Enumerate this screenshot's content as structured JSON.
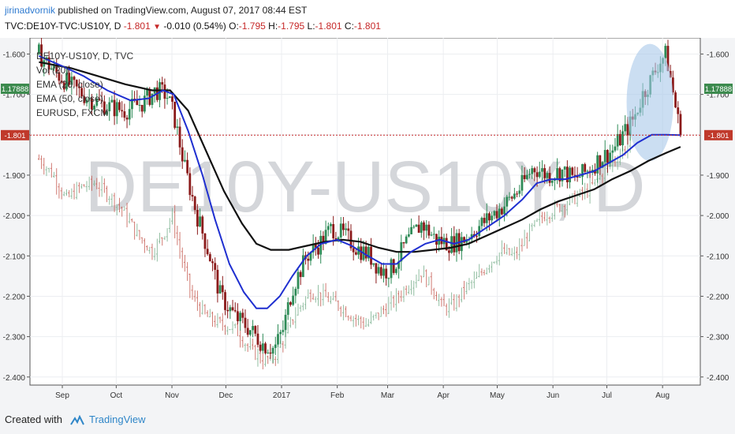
{
  "header": {
    "author": "jirinadvornik",
    "published_text": " published on TradingView.com, August 07, 2017 08:44 EST",
    "symbol": "TVC:DE10Y-TVC:US10Y, D",
    "last": "-1.801",
    "change": "-0.010 (0.54%)",
    "o_label": "O:",
    "o_value": "-1.795",
    "h_label": "H:",
    "h_value": "-1.795",
    "l_label": "L:",
    "l_value": "-1.801",
    "c_label": "C:",
    "c_value": "-1.801"
  },
  "footer": {
    "created_with": "Created with",
    "brand": "TradingView"
  },
  "colors": {
    "candle_up": "#2e8b57",
    "candle_down": "#8b1a1a",
    "ema20": "#1f2fd0",
    "ema50": "#111111",
    "eurusd": "#c8635a",
    "price_line": "#c62828",
    "highlight": "#a8c8ea",
    "badge_green": "#3c8a4e",
    "badge_red": "#c0392b",
    "watermark": "#d4d6da"
  },
  "chart_data": {
    "type": "candlestick",
    "watermark": "DE10Y-US10Y, D",
    "legend": [
      "DE10Y-US10Y, D, TVC",
      "Vol (20)",
      "EMA (20, close)",
      "EMA (50, close)",
      "EURUSD, FXCM"
    ],
    "y_axis_left": {
      "min": -2.42,
      "max": -1.56,
      "ticks": [
        "-1.600",
        "-1.700",
        "-1.800",
        "-1.900",
        "-2.000",
        "-2.100",
        "-2.200",
        "-2.300",
        "-2.400"
      ]
    },
    "y_axis_right": {
      "min": -2.42,
      "max": -1.56,
      "ticks": [
        "-1.600",
        "-1.700",
        "-1.900",
        "-2.000",
        "-2.100",
        "-2.200",
        "-2.300",
        "-2.400"
      ]
    },
    "left_badges": [
      {
        "label": "1.17888",
        "value": -1.686,
        "style": "green"
      },
      {
        "label": "-1.801",
        "value": -1.801,
        "style": "red"
      }
    ],
    "right_badges": [
      {
        "label": "1.17888",
        "value": -1.686,
        "style": "green"
      },
      {
        "label": "-1.801",
        "value": -1.801,
        "style": "red"
      }
    ],
    "current_price": -1.801,
    "x_labels": [
      {
        "label": "Sep",
        "day": 10
      },
      {
        "label": "Oct",
        "day": 40
      },
      {
        "label": "Nov",
        "day": 71
      },
      {
        "label": "Dec",
        "day": 101
      },
      {
        "label": "2017",
        "day": 132
      },
      {
        "label": "Feb",
        "day": 163
      },
      {
        "label": "Mar",
        "day": 191
      },
      {
        "label": "Apr",
        "day": 222
      },
      {
        "label": "May",
        "day": 252
      },
      {
        "label": "Jun",
        "day": 283
      },
      {
        "label": "Jul",
        "day": 313
      },
      {
        "label": "Aug",
        "day": 344
      }
    ],
    "x_domain": [
      -8,
      365
    ],
    "price_path": [
      [
        -3,
        -1.6
      ],
      [
        5,
        -1.64
      ],
      [
        15,
        -1.68
      ],
      [
        25,
        -1.71
      ],
      [
        35,
        -1.73
      ],
      [
        45,
        -1.74
      ],
      [
        55,
        -1.72
      ],
      [
        62,
        -1.69
      ],
      [
        68,
        -1.7
      ],
      [
        72,
        -1.75
      ],
      [
        78,
        -1.88
      ],
      [
        85,
        -2.0
      ],
      [
        92,
        -2.1
      ],
      [
        98,
        -2.2
      ],
      [
        106,
        -2.25
      ],
      [
        114,
        -2.28
      ],
      [
        122,
        -2.32
      ],
      [
        128,
        -2.33
      ],
      [
        133,
        -2.28
      ],
      [
        138,
        -2.18
      ],
      [
        146,
        -2.1
      ],
      [
        153,
        -2.07
      ],
      [
        160,
        -2.03
      ],
      [
        167,
        -2.05
      ],
      [
        174,
        -2.08
      ],
      [
        181,
        -2.1
      ],
      [
        188,
        -2.14
      ],
      [
        194,
        -2.13
      ],
      [
        201,
        -2.07
      ],
      [
        210,
        -2.02
      ],
      [
        218,
        -2.06
      ],
      [
        226,
        -2.07
      ],
      [
        233,
        -2.06
      ],
      [
        241,
        -2.03
      ],
      [
        249,
        -2.0
      ],
      [
        257,
        -1.97
      ],
      [
        265,
        -1.93
      ],
      [
        272,
        -1.88
      ],
      [
        280,
        -1.9
      ],
      [
        288,
        -1.89
      ],
      [
        295,
        -1.91
      ],
      [
        302,
        -1.89
      ],
      [
        309,
        -1.86
      ],
      [
        316,
        -1.84
      ],
      [
        322,
        -1.8
      ],
      [
        328,
        -1.76
      ],
      [
        333,
        -1.7
      ],
      [
        338,
        -1.66
      ],
      [
        342,
        -1.62
      ],
      [
        346,
        -1.6
      ],
      [
        350,
        -1.7
      ],
      [
        354,
        -1.8
      ]
    ],
    "ema20": [
      [
        -3,
        -1.605
      ],
      [
        10,
        -1.63
      ],
      [
        22,
        -1.655
      ],
      [
        35,
        -1.69
      ],
      [
        48,
        -1.715
      ],
      [
        58,
        -1.71
      ],
      [
        66,
        -1.69
      ],
      [
        72,
        -1.7
      ],
      [
        80,
        -1.79
      ],
      [
        88,
        -1.9
      ],
      [
        95,
        -2.01
      ],
      [
        103,
        -2.12
      ],
      [
        111,
        -2.19
      ],
      [
        118,
        -2.23
      ],
      [
        124,
        -2.23
      ],
      [
        131,
        -2.2
      ],
      [
        138,
        -2.15
      ],
      [
        146,
        -2.1
      ],
      [
        154,
        -2.07
      ],
      [
        163,
        -2.06
      ],
      [
        171,
        -2.075
      ],
      [
        180,
        -2.1
      ],
      [
        188,
        -2.12
      ],
      [
        196,
        -2.12
      ],
      [
        204,
        -2.09
      ],
      [
        212,
        -2.07
      ],
      [
        220,
        -2.06
      ],
      [
        228,
        -2.07
      ],
      [
        236,
        -2.06
      ],
      [
        246,
        -2.03
      ],
      [
        256,
        -2.0
      ],
      [
        266,
        -1.96
      ],
      [
        274,
        -1.92
      ],
      [
        282,
        -1.91
      ],
      [
        290,
        -1.91
      ],
      [
        298,
        -1.9
      ],
      [
        306,
        -1.89
      ],
      [
        314,
        -1.87
      ],
      [
        322,
        -1.85
      ],
      [
        330,
        -1.82
      ],
      [
        338,
        -1.8
      ],
      [
        346,
        -1.8
      ],
      [
        354,
        -1.801
      ]
    ],
    "ema50": [
      [
        -3,
        -1.62
      ],
      [
        15,
        -1.635
      ],
      [
        30,
        -1.655
      ],
      [
        45,
        -1.675
      ],
      [
        60,
        -1.69
      ],
      [
        70,
        -1.69
      ],
      [
        80,
        -1.74
      ],
      [
        90,
        -1.84
      ],
      [
        100,
        -1.94
      ],
      [
        110,
        -2.02
      ],
      [
        118,
        -2.07
      ],
      [
        126,
        -2.085
      ],
      [
        136,
        -2.085
      ],
      [
        146,
        -2.075
      ],
      [
        156,
        -2.065
      ],
      [
        166,
        -2.06
      ],
      [
        176,
        -2.065
      ],
      [
        186,
        -2.08
      ],
      [
        196,
        -2.09
      ],
      [
        206,
        -2.09
      ],
      [
        216,
        -2.085
      ],
      [
        226,
        -2.08
      ],
      [
        236,
        -2.07
      ],
      [
        246,
        -2.05
      ],
      [
        256,
        -2.03
      ],
      [
        266,
        -2.01
      ],
      [
        276,
        -1.985
      ],
      [
        286,
        -1.965
      ],
      [
        296,
        -1.95
      ],
      [
        306,
        -1.935
      ],
      [
        316,
        -1.91
      ],
      [
        326,
        -1.89
      ],
      [
        336,
        -1.865
      ],
      [
        346,
        -1.845
      ],
      [
        354,
        -1.83
      ]
    ],
    "eurusd_path": [
      [
        -3,
        -1.86
      ],
      [
        5,
        -1.9
      ],
      [
        12,
        -1.96
      ],
      [
        20,
        -1.93
      ],
      [
        28,
        -1.92
      ],
      [
        36,
        -1.95
      ],
      [
        44,
        -1.99
      ],
      [
        52,
        -2.05
      ],
      [
        60,
        -2.09
      ],
      [
        66,
        -2.05
      ],
      [
        71,
        -2.0
      ],
      [
        76,
        -2.1
      ],
      [
        82,
        -2.2
      ],
      [
        90,
        -2.25
      ],
      [
        98,
        -2.27
      ],
      [
        106,
        -2.28
      ],
      [
        114,
        -2.33
      ],
      [
        122,
        -2.36
      ],
      [
        128,
        -2.35
      ],
      [
        134,
        -2.3
      ],
      [
        140,
        -2.24
      ],
      [
        148,
        -2.19
      ],
      [
        155,
        -2.2
      ],
      [
        163,
        -2.22
      ],
      [
        171,
        -2.25
      ],
      [
        179,
        -2.27
      ],
      [
        187,
        -2.24
      ],
      [
        195,
        -2.21
      ],
      [
        203,
        -2.17
      ],
      [
        210,
        -2.14
      ],
      [
        216,
        -2.18
      ],
      [
        222,
        -2.23
      ],
      [
        228,
        -2.22
      ],
      [
        234,
        -2.18
      ],
      [
        240,
        -2.16
      ],
      [
        247,
        -2.12
      ],
      [
        254,
        -2.09
      ],
      [
        262,
        -2.1
      ],
      [
        270,
        -2.04
      ],
      [
        278,
        -2.0
      ],
      [
        286,
        -1.98
      ],
      [
        294,
        -1.96
      ],
      [
        302,
        -1.94
      ],
      [
        310,
        -1.9
      ],
      [
        318,
        -1.86
      ],
      [
        326,
        -1.82
      ]
    ],
    "highlight": {
      "cx_day": 337,
      "cy_value": -1.72,
      "rx_days": 13,
      "ry_value": 0.145
    }
  }
}
